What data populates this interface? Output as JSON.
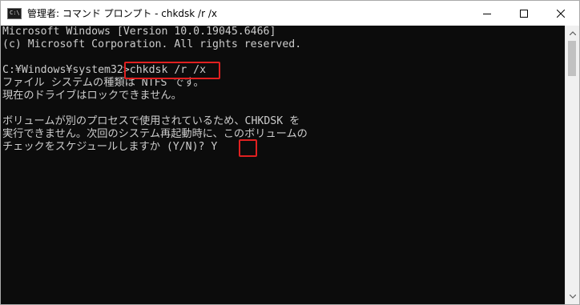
{
  "window": {
    "title": "管理者: コマンド プロンプト - chkdsk  /r /x",
    "icon_label": "C:\\",
    "controls": [
      "minimize",
      "maximize",
      "close"
    ]
  },
  "console": {
    "lines": [
      "Microsoft Windows [Version 10.0.19045.6466]",
      "(c) Microsoft Corporation. All rights reserved.",
      "",
      "C:¥Windows¥system32>chkdsk /r /x",
      "ファイル システムの種類は NTFS です。",
      "現在のドライブはロックできません。",
      "",
      "ボリュームが別のプロセスで使用されているため、CHKDSK を",
      "実行できません。次回のシステム再起動時に、このボリュームの",
      "チェックをスケジュールしますか (Y/N)? Y"
    ],
    "text_color": "#cccccc",
    "background_color": "#0c0c0c"
  },
  "annotations": {
    "highlight_color": "#e02020",
    "highlighted": [
      "chkdsk /r /x",
      "Y"
    ]
  }
}
